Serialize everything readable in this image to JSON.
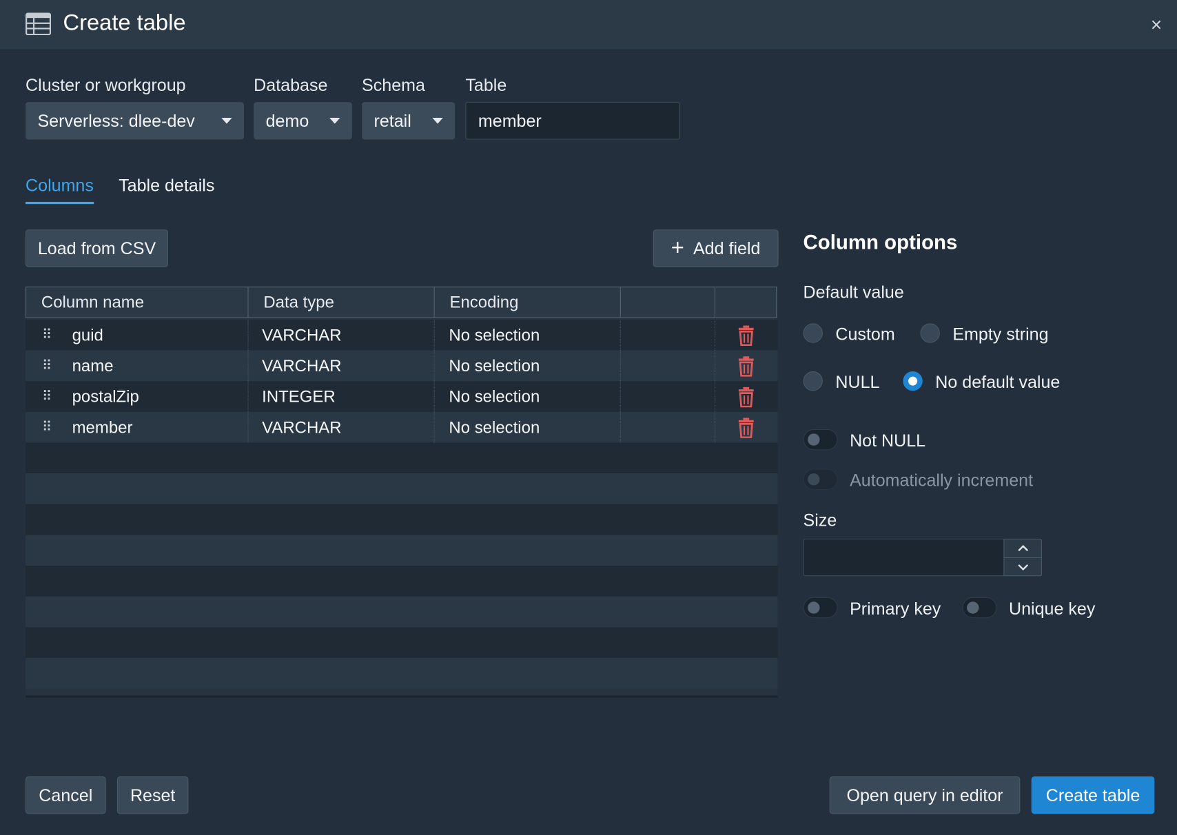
{
  "dialog": {
    "title": "Create table",
    "close_label": "×"
  },
  "selectors": {
    "cluster": {
      "label": "Cluster or workgroup",
      "value": "Serverless: dlee-dev"
    },
    "database": {
      "label": "Database",
      "value": "demo"
    },
    "schema": {
      "label": "Schema",
      "value": "retail"
    },
    "table": {
      "label": "Table",
      "value": "member"
    }
  },
  "tabs": [
    {
      "label": "Columns",
      "active": true
    },
    {
      "label": "Table details",
      "active": false
    }
  ],
  "toolbar": {
    "load_csv": "Load from CSV",
    "add_field": "Add field"
  },
  "grid": {
    "headers": [
      "Column name",
      "Data type",
      "Encoding",
      "",
      ""
    ],
    "rows": [
      {
        "name": "guid",
        "type": "VARCHAR",
        "encoding": "No selection"
      },
      {
        "name": "name",
        "type": "VARCHAR",
        "encoding": "No selection"
      },
      {
        "name": "postalZip",
        "type": "INTEGER",
        "encoding": "No selection"
      },
      {
        "name": "member",
        "type": "VARCHAR",
        "encoding": "No selection"
      }
    ]
  },
  "column_options": {
    "title": "Column options",
    "default_value_label": "Default value",
    "radios": {
      "custom": "Custom",
      "empty_string": "Empty string",
      "null": "NULL",
      "no_default": "No default value",
      "selected": "no_default"
    },
    "not_null": "Not NULL",
    "auto_increment": "Automatically increment",
    "size_label": "Size",
    "size_value": "",
    "primary_key": "Primary key",
    "unique_key": "Unique key"
  },
  "footer": {
    "cancel": "Cancel",
    "reset": "Reset",
    "open_query": "Open query in editor",
    "create": "Create table"
  },
  "colors": {
    "accent": "#1f86d4",
    "tab_active": "#42a5ea",
    "delete": "#e05a5a",
    "background": "#232f3c"
  }
}
